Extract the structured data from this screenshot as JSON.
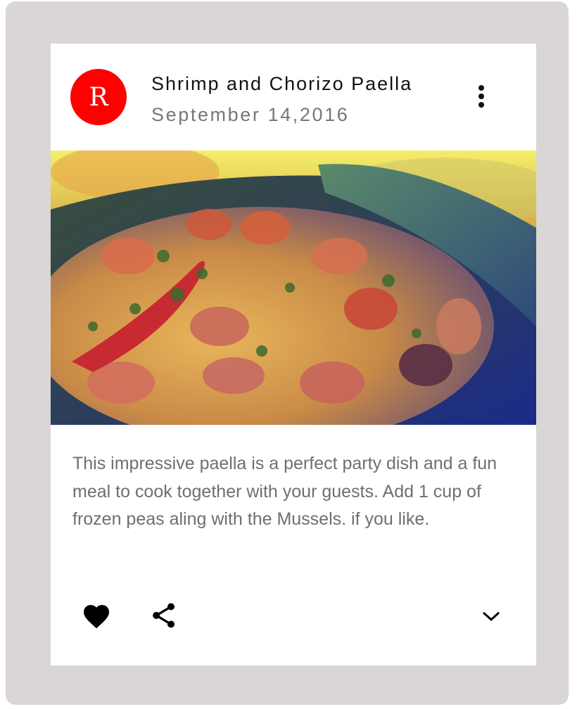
{
  "card": {
    "avatar_letter": "R",
    "title": "Shrimp and Chorizo Paella",
    "subheader": "September 14,2016",
    "description": "This impressive paella is a perfect party dish and a fun meal to cook together with your guests. Add 1 cup of frozen peas aling with the Mussels. if you like.",
    "colors": {
      "avatar_bg": "#ff0000",
      "frame_bg": "#d9d6d5",
      "text_secondary": "#6f6f6f"
    },
    "icons": {
      "menu": "more-vert-icon",
      "like": "favorite-icon",
      "share": "share-icon",
      "expand": "expand-more-icon"
    }
  }
}
